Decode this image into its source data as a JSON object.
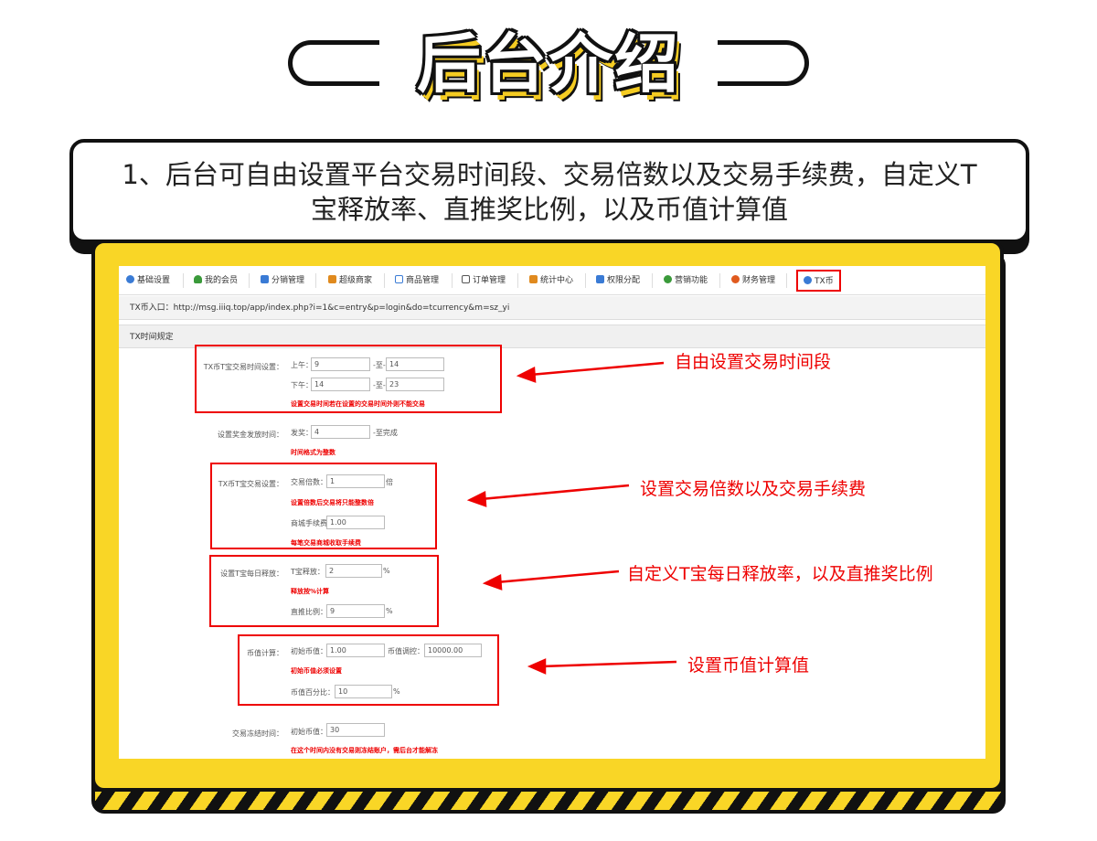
{
  "heading": {
    "title": "后台介绍"
  },
  "description": "1、后台可自由设置平台交易时间段、交易倍数以及交易手续费，自定义T宝释放率、直推奖比例，以及币值计算值",
  "tabs": [
    {
      "label": "基础设置",
      "icon": "gear-icon",
      "color": "#3a7bd5"
    },
    {
      "label": "我的会员",
      "icon": "user-icon",
      "color": "#3a9a3a"
    },
    {
      "label": "分销管理",
      "icon": "tree-icon",
      "color": "#3a7bd5"
    },
    {
      "label": "超级商家",
      "icon": "store-icon",
      "color": "#e08a1e"
    },
    {
      "label": "商品管理",
      "icon": "grid-icon",
      "color": "#3a7bd5"
    },
    {
      "label": "订单管理",
      "icon": "order-icon",
      "color": "#555555"
    },
    {
      "label": "统计中心",
      "icon": "chart-icon",
      "color": "#e08a1e"
    },
    {
      "label": "权限分配",
      "icon": "key-icon",
      "color": "#3a7bd5"
    },
    {
      "label": "营销功能",
      "icon": "marketing-icon",
      "color": "#3a9a3a"
    },
    {
      "label": "财务管理",
      "icon": "finance-icon",
      "color": "#e05a1e"
    },
    {
      "label": "TX币",
      "icon": "gear-icon",
      "color": "#3a7bd5"
    }
  ],
  "entry": {
    "label": "TX币入口：",
    "url": "http://msg.iiiq.top/app/index.php?i=1&c=entry&p=login&do=tcurrency&m=sz_yi"
  },
  "section_title": "TX时间规定",
  "trade_time": {
    "label": "TX币T宝交易时间设置：",
    "am_label": "上午：",
    "am_start": "9",
    "am_end": "14",
    "pm_label": "下午：",
    "pm_start": "14",
    "pm_end": "23",
    "to": "-至-",
    "warning": "设置交易时间若在设置的交易时间外则不能交易"
  },
  "bonus_time": {
    "label": "设置奖金发放时间：",
    "field_label": "发奖：",
    "value": "4",
    "suffix": "-至完成",
    "warning": "时间格式为整数"
  },
  "trade_setting": {
    "label": "TX币T宝交易设置：",
    "multiple_label": "交易倍数：",
    "multiple_value": "1",
    "multiple_unit": "倍",
    "multiple_warning": "设置倍数后交易将只能整数倍",
    "fee_label": "商城手续费",
    "fee_value": "1.00",
    "fee_warning": "每笔交易商城收取手续费"
  },
  "daily_release": {
    "label": "设置T宝每日释放：",
    "release_label": "T宝释放：",
    "release_value": "2",
    "release_unit": "%",
    "release_warning": "释放按%计算",
    "referral_label": "直推比例：",
    "referral_value": "9",
    "referral_unit": "%"
  },
  "coin_value": {
    "label": "币值计算：",
    "initial_label": "初始币值：",
    "initial_value": "1.00",
    "adjust_label": "币值调控：",
    "adjust_value": "10000.00",
    "warning": "初始币值必须设置",
    "percent_label": "币值百分比：",
    "percent_value": "10",
    "percent_unit": "%"
  },
  "freeze_time": {
    "label": "交易冻结时间：",
    "field_label": "初始币值：",
    "value": "30",
    "warning": "在这个时间内没有交易则冻结账户，需后台才能解冻"
  },
  "annotations": [
    "自由设置交易时间段",
    "设置交易倍数以及交易手续费",
    "自定义T宝每日释放率，以及直推奖比例",
    "设置币值计算值"
  ],
  "colors": {
    "accent_yellow": "#f9d626",
    "annotation_red": "#e00000",
    "outline": "#111111"
  }
}
